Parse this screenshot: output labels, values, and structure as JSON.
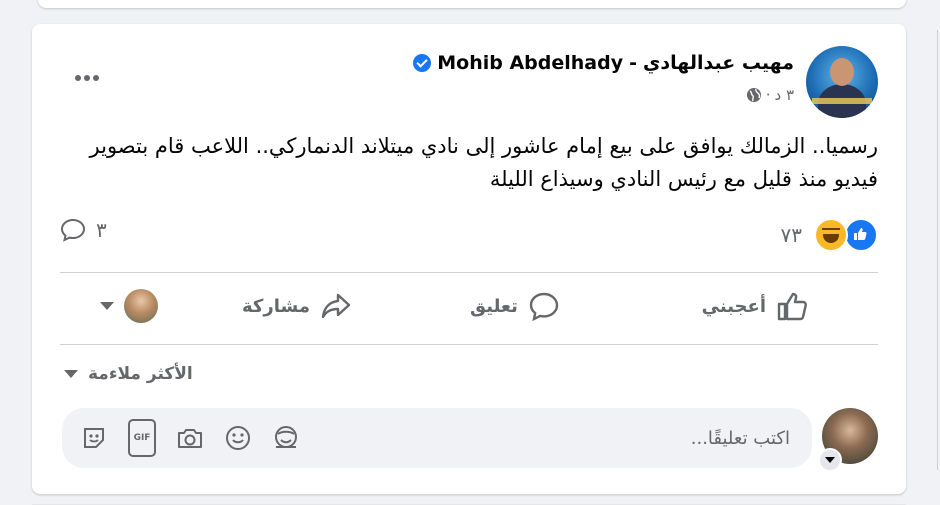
{
  "post": {
    "author_arabic": "مهيب عبدالهادي",
    "separator": "-",
    "author_latin": "Mohib Abdelhady",
    "time": "٣ د",
    "text": "رسميا.. الزمالك يوافق على بيع إمام عاشور إلى نادي ميتلاند الدنماركي.. اللاعب قام بتصوير فيديو منذ قليل مع رئيس النادي وسيذاع الليلة"
  },
  "stats": {
    "reactions_count": "٧٣",
    "comments_count": "٣"
  },
  "actions": {
    "like_label": "أعجبني",
    "comment_label": "تعليق",
    "share_label": "مشاركة"
  },
  "comments_section": {
    "sort_label": "الأكثر ملاءمة",
    "input_placeholder": "اكتب تعليقًا..."
  },
  "icons": {
    "more": "more-dots-icon",
    "verified": "verified-badge-icon",
    "globe": "globe-icon",
    "like_reaction": "like-reaction-icon",
    "haha_reaction": "haha-reaction-icon",
    "comment_bubble": "comment-bubble-icon",
    "thumbs_up": "thumbs-up-icon",
    "share_arrow": "share-arrow-icon",
    "sticker": "sticker-icon",
    "gif": "gif-icon",
    "camera": "camera-icon",
    "emoji": "emoji-icon",
    "avatar_sticker": "avatar-sticker-icon"
  },
  "colors": {
    "accent": "#1877f2",
    "secondary_text": "#65676b",
    "haha": "#f7b928"
  }
}
